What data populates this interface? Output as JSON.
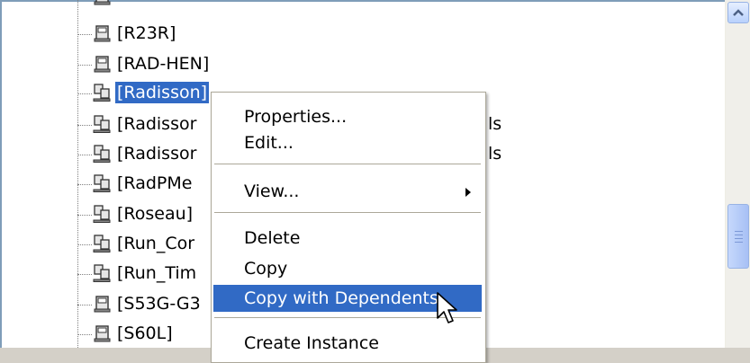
{
  "tree": {
    "items": [
      {
        "label": "[R23R]",
        "icon": "single-node-icon"
      },
      {
        "label": "[RAD-HEN]",
        "icon": "single-node-icon"
      },
      {
        "label": "[Radisson]",
        "icon": "multi-node-icon",
        "selected": true
      },
      {
        "label": "[Radissor",
        "suffix": "ls",
        "icon": "multi-node-icon"
      },
      {
        "label": "[Radissor",
        "suffix": "ls",
        "icon": "multi-node-icon"
      },
      {
        "label": "[RadPMe",
        "icon": "multi-node-icon"
      },
      {
        "label": "[Roseau]",
        "icon": "multi-node-icon"
      },
      {
        "label": "[Run_Cor",
        "icon": "multi-node-icon"
      },
      {
        "label": "[Run_Tim",
        "icon": "multi-node-icon"
      },
      {
        "label": "[S53G-G3",
        "icon": "single-node-icon"
      },
      {
        "label": "[S60L]",
        "icon": "single-node-icon"
      }
    ]
  },
  "context_menu": {
    "properties": "Properties...",
    "edit": "Edit...",
    "view": "View...",
    "delete": "Delete",
    "copy": "Copy",
    "copy_with_dependents": "Copy with Dependents",
    "create_instance": "Create Instance"
  },
  "colors": {
    "selection": "#316ac5",
    "menu_border": "#aca899"
  }
}
